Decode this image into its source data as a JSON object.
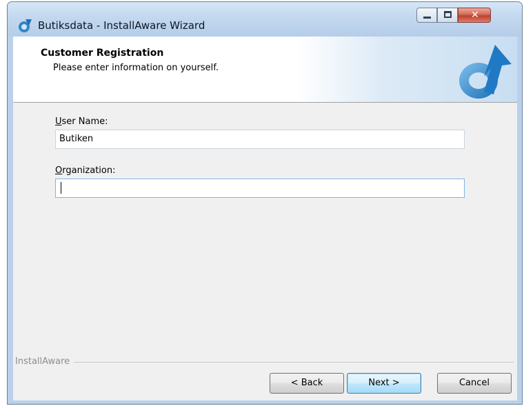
{
  "window": {
    "title": "Butiksdata - InstallAware Wizard",
    "controls": {
      "minimize": "—",
      "maximize": "☐",
      "close": "✕"
    }
  },
  "header": {
    "title": "Customer Registration",
    "subtitle": "Please enter information on yourself."
  },
  "form": {
    "username_label_accel": "U",
    "username_label_rest": "ser Name:",
    "username_value": "Butiken",
    "organization_label_accel": "O",
    "organization_label_rest": "rganization:",
    "organization_value": ""
  },
  "footer": {
    "brand": "InstallAware",
    "back_label": "< Back",
    "next_label": "Next >",
    "cancel_label": "Cancel"
  },
  "colors": {
    "accent": "#3c7fb1",
    "logo_blue": "#2f86c8"
  }
}
